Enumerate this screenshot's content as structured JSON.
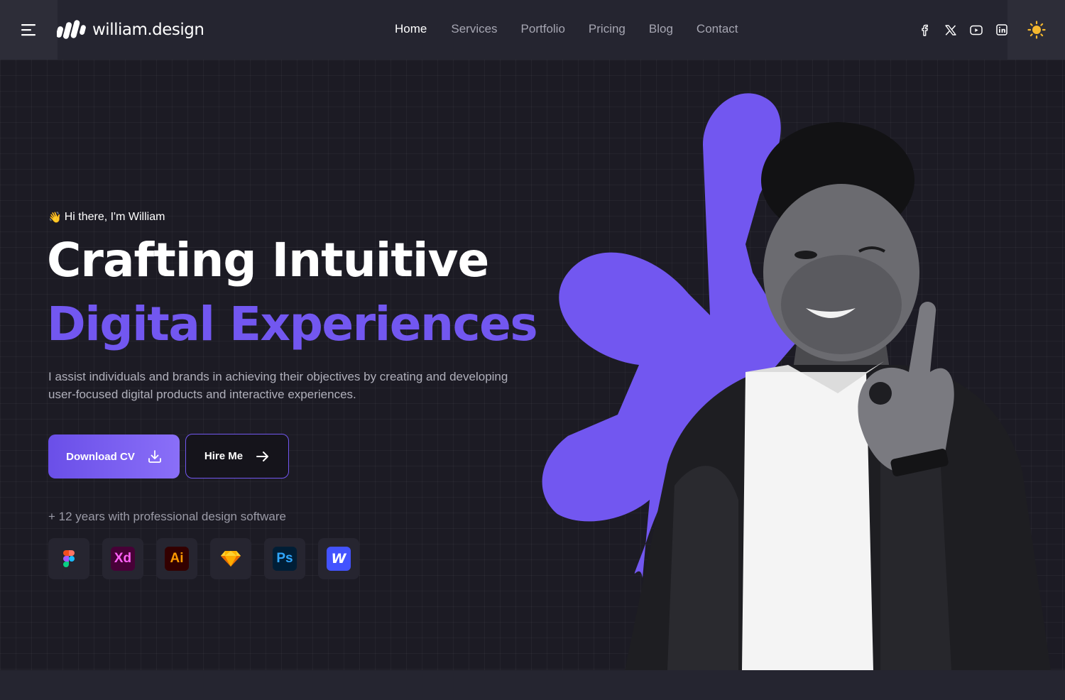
{
  "brand": {
    "name": "william.design"
  },
  "nav": {
    "items": [
      "Home",
      "Services",
      "Portfolio",
      "Pricing",
      "Blog",
      "Contact"
    ],
    "active": "Home"
  },
  "socials": [
    "facebook-icon",
    "x-icon",
    "youtube-icon",
    "linkedin-icon"
  ],
  "hero": {
    "greeting": "Hi there, I'm William",
    "greeting_emoji": "👋",
    "title_line1": "Crafting Intuitive",
    "title_line2": "Digital Experiences",
    "description": "I assist individuals and brands in achieving their objectives by creating and developing user-focused digital products and interactive experiences.",
    "primary_button": "Download CV",
    "secondary_button": "Hire Me",
    "years_text": "+ 12 years with professional design software"
  },
  "tools": [
    {
      "name": "figma-icon",
      "label": ""
    },
    {
      "name": "adobe-xd-icon",
      "label": "Xd"
    },
    {
      "name": "adobe-illustrator-icon",
      "label": "Ai"
    },
    {
      "name": "sketch-icon",
      "label": ""
    },
    {
      "name": "photoshop-icon",
      "label": "Ps"
    },
    {
      "name": "webflow-icon",
      "label": "W"
    }
  ],
  "colors": {
    "accent": "#7257f0",
    "background": "#1c1b24",
    "header": "#252530",
    "sun": "#f5b82e"
  }
}
